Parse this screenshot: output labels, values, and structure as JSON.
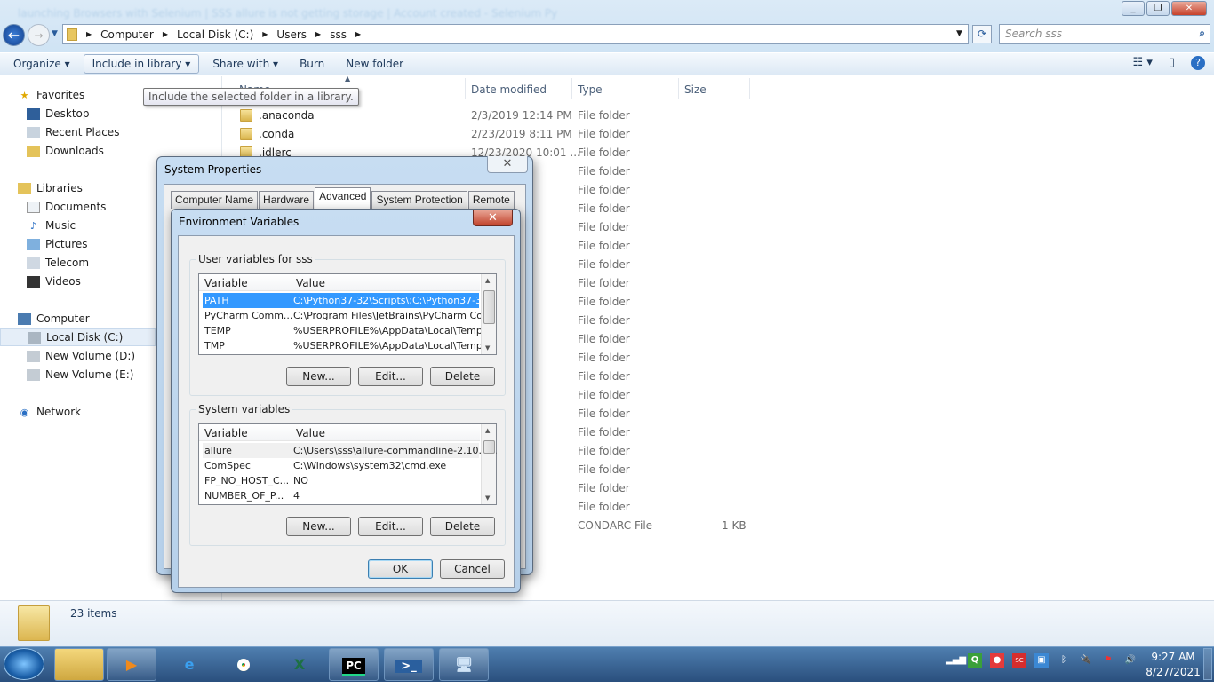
{
  "background_tabs": "launching Browsers with Selenium   |   SSS allure is not getting storage   |   Account created - Selenium Py",
  "explorer": {
    "breadcrumb": [
      "Computer",
      "Local Disk (C:)",
      "Users",
      "sss"
    ],
    "search_placeholder": "Search sss",
    "toolbar": [
      "Organize",
      "Include in library",
      "Share with",
      "Burn",
      "New folder"
    ],
    "tooltip": "Include the selected folder in a library.",
    "nav": {
      "favorites": {
        "label": "Favorites",
        "items": [
          "Desktop",
          "Recent Places",
          "Downloads"
        ]
      },
      "libraries": {
        "label": "Libraries",
        "items": [
          "Documents",
          "Music",
          "Pictures",
          "Telecom",
          "Videos"
        ]
      },
      "computer": {
        "label": "Computer",
        "items": [
          "Local Disk (C:)",
          "New Volume (D:)",
          "New Volume (E:)"
        ],
        "selected": "Local Disk (C:)"
      },
      "network": {
        "label": "Network"
      }
    },
    "columns": [
      "Name",
      "Date modified",
      "Type",
      "Size"
    ],
    "files": [
      {
        "name": ".anaconda",
        "date": "2/3/2019 12:14 PM",
        "type": "File folder",
        "size": ""
      },
      {
        "name": ".conda",
        "date": "2/23/2019 8:11 PM",
        "type": "File folder",
        "size": ""
      },
      {
        "name": ".idlerc",
        "date": "12/23/2020 10:01 ...",
        "type": "File folder",
        "size": ""
      },
      {
        "name": "",
        "date": "1 PM",
        "type": "File folder",
        "size": ""
      },
      {
        "name": "",
        "date": "3 AM",
        "type": "File folder",
        "size": ""
      },
      {
        "name": "",
        "date": "9 PM",
        "type": "File folder",
        "size": ""
      },
      {
        "name": "",
        "date": "42 PM",
        "type": "File folder",
        "size": ""
      },
      {
        "name": "",
        "date": "0 PM",
        "type": "File folder",
        "size": ""
      },
      {
        "name": "",
        "date": "52 AM",
        "type": "File folder",
        "size": ""
      },
      {
        "name": "",
        "date": "58 PM",
        "type": "File folder",
        "size": ""
      },
      {
        "name": "",
        "date": "51 PM",
        "type": "File folder",
        "size": ""
      },
      {
        "name": "",
        "date": "5 AM",
        "type": "File folder",
        "size": ""
      },
      {
        "name": "",
        "date": "1 PM",
        "type": "File folder",
        "size": ""
      },
      {
        "name": "",
        "date": "51 PM",
        "type": "File folder",
        "size": ""
      },
      {
        "name": "",
        "date": "51 PM",
        "type": "File folder",
        "size": ""
      },
      {
        "name": "",
        "date": "0 PM",
        "type": "File folder",
        "size": ""
      },
      {
        "name": "",
        "date": "1 PM",
        "type": "File folder",
        "size": ""
      },
      {
        "name": "",
        "date": "08 AM",
        "type": "File folder",
        "size": ""
      },
      {
        "name": "",
        "date": "19 AM",
        "type": "File folder",
        "size": ""
      },
      {
        "name": "",
        "date": "20 PM",
        "type": "File folder",
        "size": ""
      },
      {
        "name": "",
        "date": "51 PM",
        "type": "File folder",
        "size": ""
      },
      {
        "name": "",
        "date": "51 PM",
        "type": "File folder",
        "size": ""
      },
      {
        "name": "",
        "date": "21 AM",
        "type": "CONDARC File",
        "size": "1 KB"
      }
    ],
    "status": "23 items"
  },
  "system_properties": {
    "title": "System Properties",
    "tabs": [
      "Computer Name",
      "Hardware",
      "Advanced",
      "System Protection",
      "Remote"
    ],
    "active_tab": "Advanced"
  },
  "env_vars": {
    "title": "Environment Variables",
    "user_group": "User variables for sss",
    "system_group": "System variables",
    "col_variable": "Variable",
    "col_value": "Value",
    "user_vars": [
      {
        "name": "PATH",
        "value": "C:\\Python37-32\\Scripts\\;C:\\Python37-3..."
      },
      {
        "name": "PyCharm Comm...",
        "value": "C:\\Program Files\\JetBrains\\PyCharm Co..."
      },
      {
        "name": "TEMP",
        "value": "%USERPROFILE%\\AppData\\Local\\Temp"
      },
      {
        "name": "TMP",
        "value": "%USERPROFILE%\\AppData\\Local\\Temp"
      }
    ],
    "system_vars": [
      {
        "name": "allure",
        "value": "C:\\Users\\sss\\allure-commandline-2.10.0..."
      },
      {
        "name": "ComSpec",
        "value": "C:\\Windows\\system32\\cmd.exe"
      },
      {
        "name": "FP_NO_HOST_C...",
        "value": "NO"
      },
      {
        "name": "NUMBER_OF_P...",
        "value": "4"
      }
    ],
    "buttons": {
      "new": "New...",
      "edit": "Edit...",
      "delete": "Delete",
      "ok": "OK",
      "cancel": "Cancel"
    }
  },
  "taskbar": {
    "apps": [
      "file-explorer",
      "media-player",
      "internet-explorer",
      "chrome",
      "excel",
      "pycharm",
      "powershell",
      "remote-desktop"
    ],
    "pycharm_label": "PC",
    "time": "9:27 AM",
    "date": "8/27/2021"
  }
}
